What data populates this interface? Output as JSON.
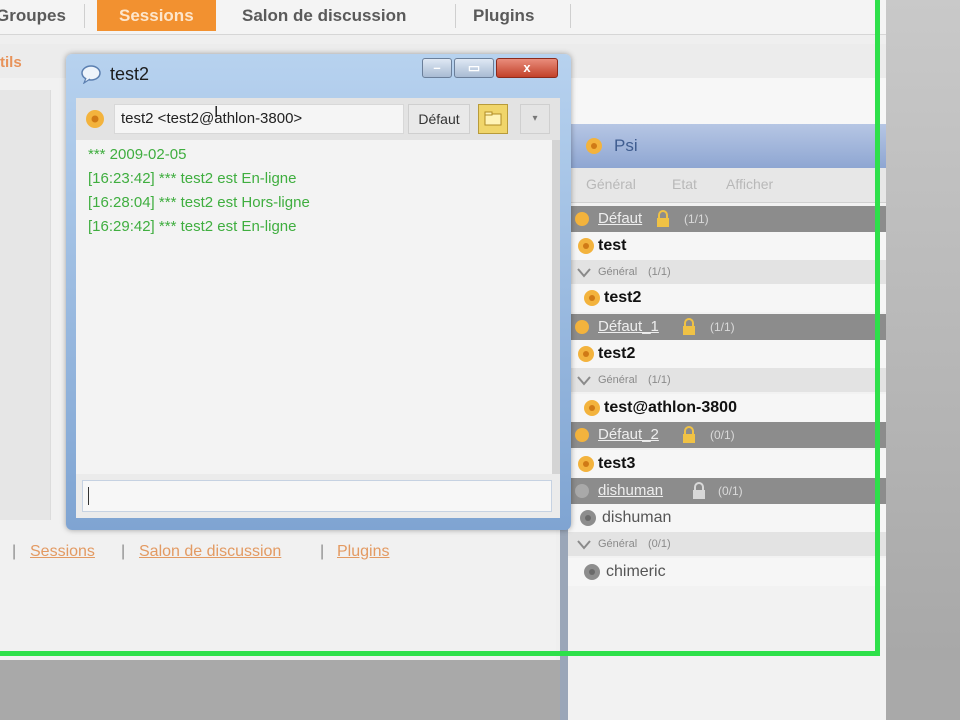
{
  "top_nav": {
    "tabs": [
      {
        "label": "Groupes",
        "active": false
      },
      {
        "label": "Sessions",
        "active": true
      },
      {
        "label": "Salon de discussion",
        "active": false
      },
      {
        "label": "Plugins",
        "active": false
      }
    ]
  },
  "sub_nav": {
    "label": "tils"
  },
  "footer": {
    "separator": "|",
    "links": [
      "Sessions",
      "Salon de discussion",
      "Plugins"
    ]
  },
  "chat_window": {
    "title": "test2",
    "contact": "test2 <test2@athlon-3800>",
    "status_label": "Défaut",
    "dropdown_icon": "▾",
    "minimize_glyph": "–",
    "maximize_glyph": "▭",
    "close_glyph": "x",
    "log": [
      "*** 2009-02-05",
      "[16:23:42] *** test2 est En-ligne",
      "[16:28:04] *** test2 est Hors-ligne",
      "[16:29:42] *** test2 est En-ligne"
    ],
    "input_value": ""
  },
  "buddy_list": {
    "title": "Psi",
    "menu": [
      "Général",
      "Etat",
      "Afficher"
    ],
    "rows": [
      {
        "type": "group",
        "name": "Défaut",
        "count": "(1/1)"
      },
      {
        "type": "user",
        "name": "test",
        "online": true
      },
      {
        "type": "subgroup",
        "name": "Général",
        "count": "(1/1)"
      },
      {
        "type": "user",
        "name": "test2",
        "online": true
      },
      {
        "type": "group",
        "name": "Défaut_1",
        "count": "(1/1)"
      },
      {
        "type": "user",
        "name": "test2",
        "online": true
      },
      {
        "type": "subgroup",
        "name": "Général",
        "count": "(1/1)"
      },
      {
        "type": "user",
        "name": "test@athlon-3800",
        "online": true
      },
      {
        "type": "group",
        "name": "Défaut_2",
        "count": "(0/1)"
      },
      {
        "type": "user",
        "name": "test3",
        "online": true
      },
      {
        "type": "group",
        "name": "dishuman",
        "count": "(0/1)"
      },
      {
        "type": "user",
        "name": "dishuman",
        "online": false
      },
      {
        "type": "subgroup",
        "name": "Général",
        "count": "(0/1)"
      },
      {
        "type": "user",
        "name": "chimeric",
        "online": false
      }
    ]
  },
  "colors": {
    "accent": "#f29130",
    "selection_frame": "#2ee04a",
    "log_text": "#3fae3f",
    "online_icon": "#f3b33d",
    "offline_icon": "#8d8d8d"
  }
}
